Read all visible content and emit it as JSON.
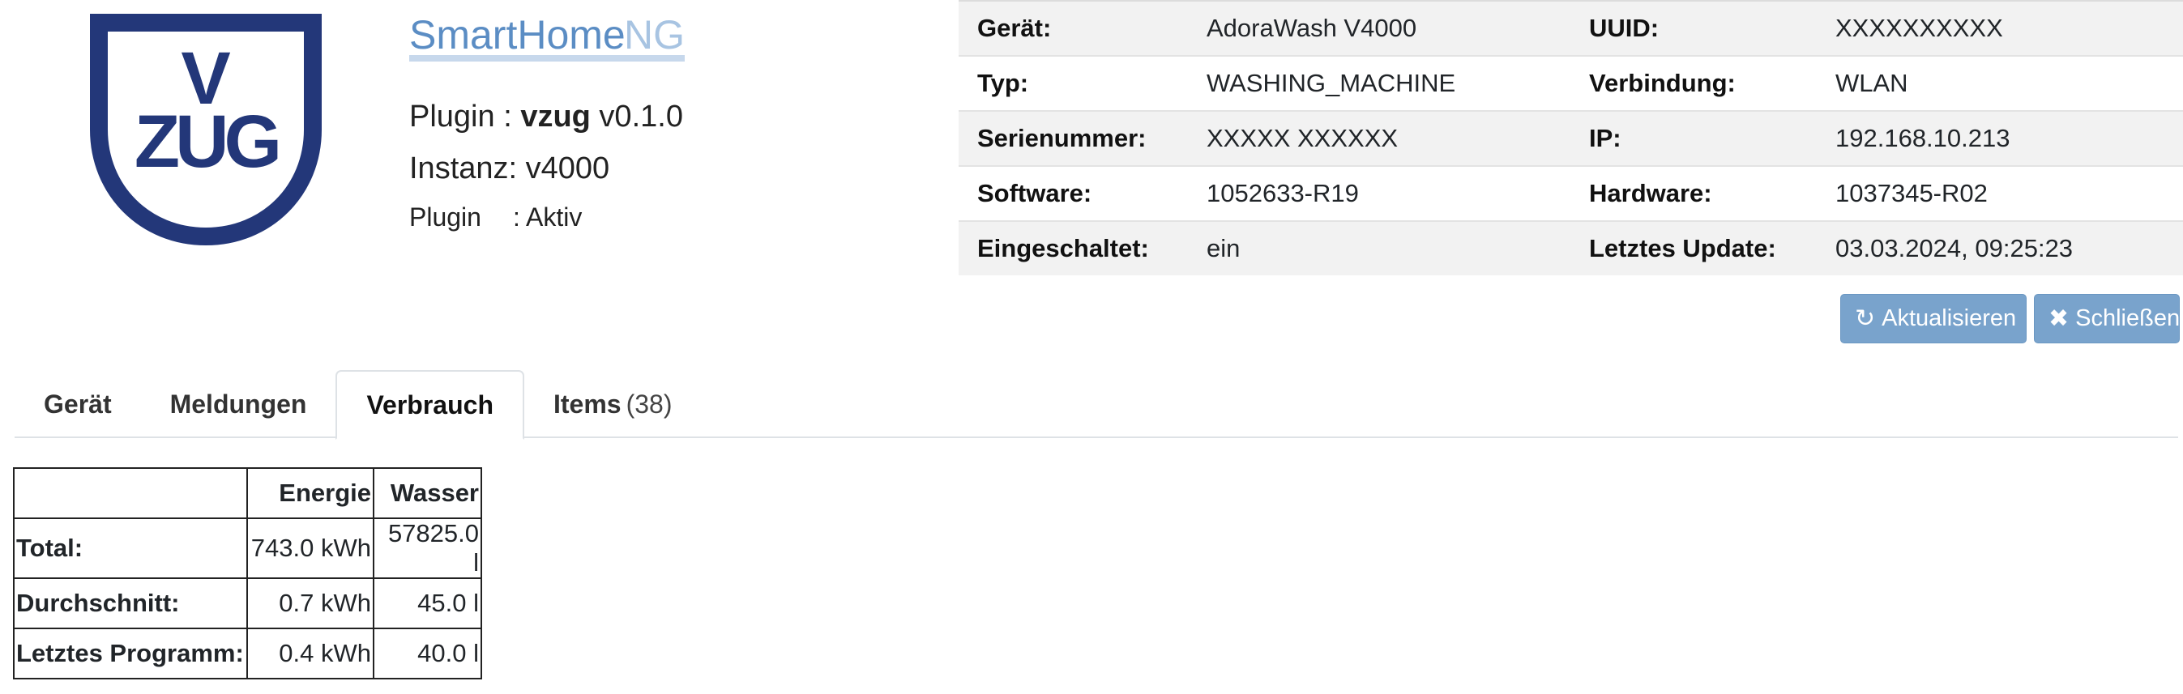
{
  "logo": {
    "letters": "V ZUG"
  },
  "brand": {
    "part1": "SmartHome",
    "part2": "NG"
  },
  "plugin_info": {
    "plugin_prefix": "Plugin : ",
    "plugin_name": "vzug",
    "plugin_version": " v0.1.0",
    "instance_label": "Instanz: ",
    "instance_value": "v4000",
    "status_label": "Plugin",
    "status_value": ": Aktiv"
  },
  "device_info": {
    "rows": [
      {
        "k1": "Gerät:",
        "v1": "AdoraWash V4000",
        "k2": "UUID:",
        "v2": "XXXXXXXXXX"
      },
      {
        "k1": "Typ:",
        "v1": "WASHING_MACHINE",
        "k2": "Verbindung:",
        "v2": "WLAN"
      },
      {
        "k1": "Serienummer:",
        "v1": "XXXXX XXXXXX",
        "k2": "IP:",
        "v2": "192.168.10.213"
      },
      {
        "k1": "Software:",
        "v1": "1052633-R19",
        "k2": "Hardware:",
        "v2": "1037345-R02"
      },
      {
        "k1": "Eingeschaltet:",
        "v1": "ein",
        "k2": "Letztes Update:",
        "v2": "03.03.2024, 09:25:23"
      }
    ]
  },
  "buttons": {
    "refresh": {
      "label": "Aktualisieren",
      "icon": "refresh-icon"
    },
    "close": {
      "label": "Schließen",
      "icon": "close-icon"
    }
  },
  "tabs": [
    {
      "label": "Gerät",
      "count": ""
    },
    {
      "label": "Meldungen",
      "count": ""
    },
    {
      "label": "Verbrauch",
      "count": "",
      "active": true
    },
    {
      "label": "Items",
      "count": "(38)"
    }
  ],
  "usage_table": {
    "headers": [
      "",
      "Energie",
      "Wasser"
    ],
    "rows": [
      {
        "label": "Total:",
        "energy": "743.0 kWh",
        "water": "57825.0 l"
      },
      {
        "label": "Durchschnitt:",
        "energy": "0.7 kWh",
        "water": "45.0 l"
      },
      {
        "label": "Letztes Programm:",
        "energy": "0.4 kWh",
        "water": "40.0 l"
      }
    ]
  },
  "colors": {
    "logo_blue": "#233779",
    "brand_blue": "#5b8dc4",
    "brand_light": "#a8c4e2",
    "button_blue": "#79a3cc",
    "stripe_gray": "#f2f2f2"
  }
}
